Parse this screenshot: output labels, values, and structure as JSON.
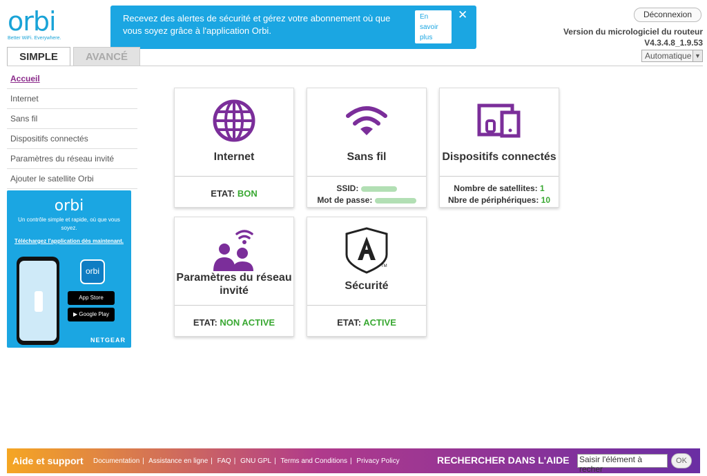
{
  "brand": {
    "logo": "orbi",
    "tagline": "Better WiFi. Everywhere."
  },
  "alert": {
    "message": "Recevez des alertes de sécurité et gérez votre abonnement où que vous soyez grâce à l'application Orbi.",
    "learn_more": "En savoir plus",
    "close": "✕"
  },
  "header": {
    "logout": "Déconnexion",
    "firmware_label": "Version du micrologiciel du routeur",
    "firmware_version": "V4.3.4.8_1.9.53",
    "language": "Automatique"
  },
  "tabs": {
    "simple": "SIMPLE",
    "advanced": "AVANCÉ"
  },
  "nav": {
    "items": [
      {
        "label": "Accueil"
      },
      {
        "label": "Internet"
      },
      {
        "label": "Sans fil"
      },
      {
        "label": "Dispositifs connectés"
      },
      {
        "label": "Paramètres du réseau invité"
      },
      {
        "label": "Ajouter le satellite Orbi"
      }
    ]
  },
  "promo": {
    "logo": "orbi",
    "text": "Un contrôle simple et rapide, où que vous soyez.",
    "download": "Téléchargez l'application dès maintenant.",
    "app_icon": "orbi",
    "app_store": "App Store",
    "google_play": "Google Play",
    "brand": "NETGEAR"
  },
  "cards": {
    "internet": {
      "title": "Internet",
      "status_label": "ETAT:",
      "status_value": "BON"
    },
    "wifi": {
      "title": "Sans fil",
      "ssid_label": "SSID:",
      "password_label": "Mot de passe:"
    },
    "devices": {
      "title": "Dispositifs connectés",
      "satellites_label": "Nombre de satellites:",
      "satellites": "1",
      "devices_label": "Nbre de périphériques:",
      "devices": "10"
    },
    "guest": {
      "title": "Paramètres du réseau invité",
      "status_label": "ETAT:",
      "status_value": "NON ACTIVE"
    },
    "security": {
      "title": "Sécurité",
      "status_label": "ETAT:",
      "status_value": "ACTIVE"
    }
  },
  "colors": {
    "accent": "#7b2e9a",
    "status_ok": "#39a832",
    "brand_blue": "#1ba6e2"
  },
  "footer": {
    "title": "Aide et support",
    "links": [
      "Documentation",
      "Assistance en ligne",
      "FAQ",
      "GNU GPL",
      "Terms and Conditions",
      "Privacy Policy"
    ],
    "search_label": "RECHERCHER DANS L'AIDE",
    "search_value": "Saisir l'élément à recher",
    "ok": "OK"
  }
}
